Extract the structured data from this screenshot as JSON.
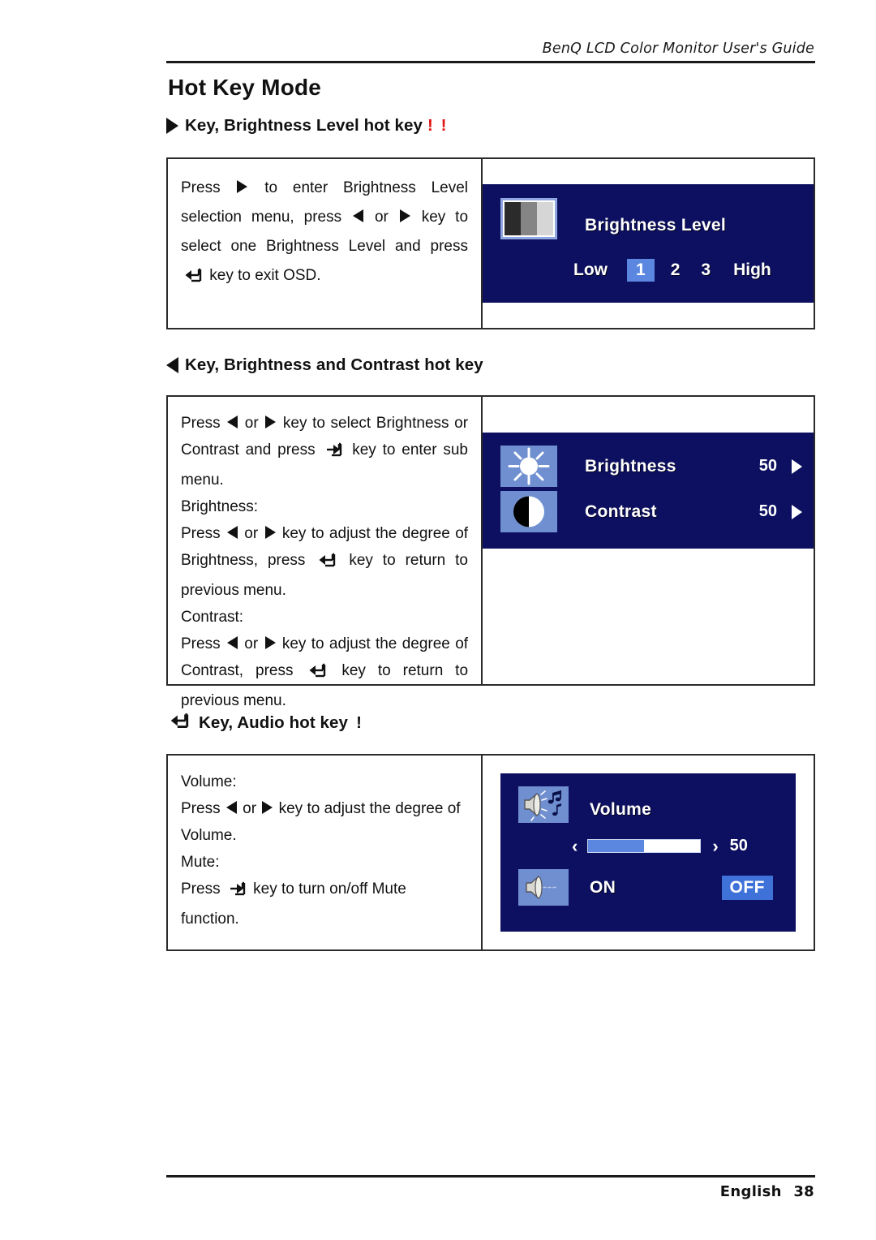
{
  "header": {
    "running_title": "BenQ LCD Color Monitor User's Guide"
  },
  "page_title": "Hot Key Mode",
  "sections": [
    {
      "id": "brightness-level",
      "icon": "triangle-right-icon",
      "heading": "Key, Brightness Level hot key",
      "marks": "! !",
      "mark_color": "#e11313",
      "instructions": {
        "l1a": "Press",
        "l1b": "to enter Brightness Level selection menu, press",
        "l1c": "or",
        "l1d": "key to select one Brightness Level and press",
        "l1e": "key to exit OSD."
      },
      "osd": {
        "title": "Brightness Level",
        "low_label": "Low",
        "high_label": "High",
        "levels": [
          "1",
          "2",
          "3"
        ],
        "selected_level": "1",
        "bg_color": "#0d1060",
        "highlight_color": "#5b87e0"
      }
    },
    {
      "id": "brightness-contrast",
      "icon": "triangle-left-icon",
      "heading": "Key, Brightness and Contrast hot key",
      "marks": "",
      "instructions": {
        "p1a": "Press",
        "p1b": "or",
        "p1c": "key to select Brightness or Contrast and press",
        "p1d": "key to enter sub menu.",
        "p2": "Brightness:",
        "p3a": "Press",
        "p3b": "or",
        "p3c": "key to adjust the degree of Brightness, press",
        "p3d": "key to return to previous menu.",
        "p4": "Contrast:",
        "p5a": "Press",
        "p5b": "or",
        "p5c": "key to adjust the degree of Contrast, press",
        "p5d": "key to return to previous menu."
      },
      "osd": {
        "rows": [
          {
            "icon": "sun-icon",
            "label": "Brightness",
            "value": "50"
          },
          {
            "icon": "contrast-circle-icon",
            "label": "Contrast",
            "value": "50"
          }
        ],
        "bg_color": "#0d1060"
      }
    },
    {
      "id": "audio",
      "icon": "exit-key-icon",
      "heading": "Key, Audio hot key",
      "marks": "!",
      "mark_color": "#111111",
      "instructions": {
        "p1": "Volume:",
        "p2a": "Press",
        "p2b": "or",
        "p2c": "key to adjust the degree of Volume.",
        "p3": "Mute:",
        "p4a": "Press",
        "p4b": "key to turn on/off Mute function."
      },
      "osd": {
        "volume_label": "Volume",
        "volume_value": "50",
        "volume_fill_percent": 50,
        "left_chevron": "‹",
        "right_chevron": "›",
        "mute_on_label": "ON",
        "mute_off_label": "OFF",
        "mute_selected": "OFF",
        "bg_color": "#0d1060",
        "highlight_color": "#3f72d8"
      }
    }
  ],
  "footer": {
    "language": "English",
    "page_number": "38"
  }
}
